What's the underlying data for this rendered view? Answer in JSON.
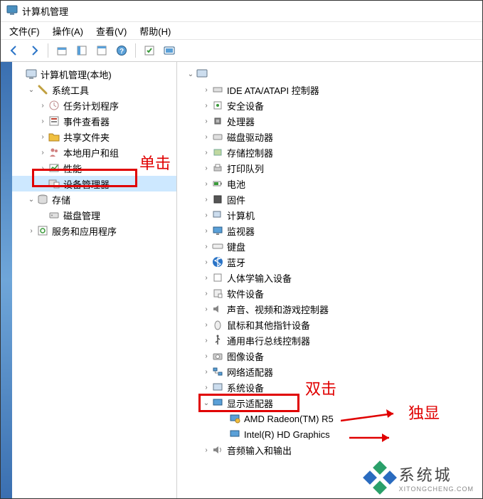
{
  "window": {
    "title": "计算机管理"
  },
  "menu": {
    "file": "文件(F)",
    "action": "操作(A)",
    "view": "查看(V)",
    "help": "帮助(H)"
  },
  "left_tree": {
    "root": "计算机管理(本地)",
    "system_tools": "系统工具",
    "task_scheduler": "任务计划程序",
    "event_viewer": "事件查看器",
    "shared_folders": "共享文件夹",
    "local_users": "本地用户和组",
    "performance": "性能",
    "device_manager": "设备管理器",
    "storage": "存储",
    "disk_management": "磁盘管理",
    "services": "服务和应用程序"
  },
  "right_tree": {
    "ide": "IDE ATA/ATAPI 控制器",
    "security_devices": "安全设备",
    "processors": "处理器",
    "disk_drives": "磁盘驱动器",
    "storage_controllers": "存储控制器",
    "print_queues": "打印队列",
    "batteries": "电池",
    "firmware": "固件",
    "computer": "计算机",
    "monitors": "监视器",
    "keyboards": "键盘",
    "bluetooth": "蓝牙",
    "hid": "人体学输入设备",
    "software_devices": "软件设备",
    "sound": "声音、视频和游戏控制器",
    "mice": "鼠标和其他指针设备",
    "usb": "通用串行总线控制器",
    "imaging": "图像设备",
    "network": "网络适配器",
    "system_devices": "系统设备",
    "display_adapters": "显示适配器",
    "amd": "AMD Radeon(TM) R5",
    "intel": "Intel(R) HD Graphics",
    "audio": "音频输入和输出"
  },
  "annotations": {
    "single_click": "单击",
    "double_click": "双击",
    "dedicated_gpu": "独显"
  },
  "watermark": {
    "cn": "系统城",
    "en": "XITONGCHENG.COM"
  }
}
